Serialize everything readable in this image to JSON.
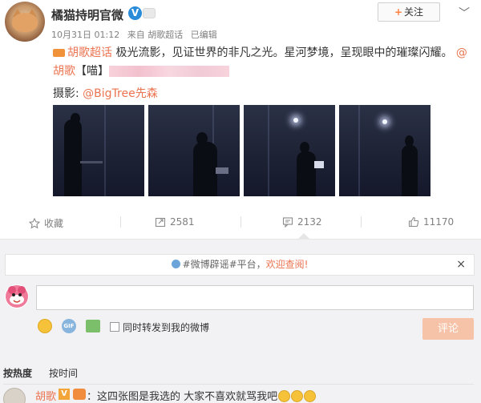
{
  "post": {
    "author": "橘猫持明官微",
    "verified_mark": "V",
    "follow_label": "关注",
    "follow_plus": "+",
    "more_glyph": "﹀",
    "meta": {
      "time": "10月31日 01:12",
      "source": "来自 胡歌超话",
      "edited": "已编辑"
    },
    "topic": "胡歌超话",
    "text": " 极光流影，见证世界的非凡之光。星河梦境，呈现眼中的璀璨闪耀。",
    "mention": "@胡歌",
    "tag": "【喵】",
    "photo_label": "摄影: ",
    "photo_credit": "@BigTree先森",
    "image_count": 4
  },
  "actions": {
    "favorite": "收藏",
    "repost": "2581",
    "comment": "2132",
    "like": "11170"
  },
  "comment_box": {
    "notice_pre": "#微博辟谣#平台，",
    "notice_warn": "欢迎查阅!",
    "close_glyph": "×",
    "input_placeholder": "",
    "gif_label": "GIF",
    "repost_checkbox_label": "同时转发到我的微博",
    "submit_label": "评论"
  },
  "sort": {
    "hot": "按热度",
    "time": "按时间"
  },
  "comments": [
    {
      "name": "胡歌",
      "badge": "V",
      "text": "：这四张图是我选的 大家不喜欢就骂我吧"
    }
  ]
}
